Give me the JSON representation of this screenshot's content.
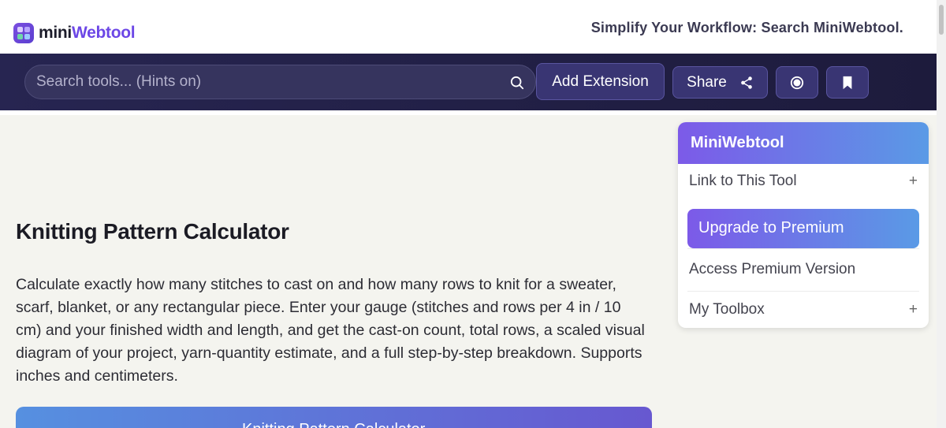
{
  "header": {
    "logo_part1": "mini",
    "logo_part2": "Webtool",
    "tagline": "Simplify Your Workflow: Search MiniWebtool."
  },
  "toolbar": {
    "search_placeholder": "Search tools... (Hints on)",
    "search_value": "",
    "add_extension_label": "Add Extension",
    "share_label": "Share",
    "icons": [
      "search-icon",
      "share-icon",
      "record-icon",
      "bookmark-icon"
    ]
  },
  "main": {
    "title": "Knitting Pattern Calculator",
    "description": "Calculate exactly how many stitches to cast on and how many rows to knit for a sweater, scarf, blanket, or any rectangular piece. Enter your gauge (stitches and rows per 4 in / 10 cm) and your finished width and length, and get the cast-on count, total rows, a scaled visual diagram of your project, yarn-quantity estimate, and a full step-by-step breakdown. Supports inches and centimeters.",
    "calculator_banner": "Knitting Pattern Calculator"
  },
  "sidebar": {
    "title": "MiniWebtool",
    "link_label": "Link to This Tool",
    "premium_button": "Upgrade to Premium",
    "access_label": "Access Premium Version",
    "toolbox_label": "My Toolbox",
    "expand_symbol": "+"
  },
  "colors": {
    "brand_purple": "#6c47e6",
    "toolbar_bg": "#272551",
    "button_bg": "#393573",
    "page_bg": "#f4f4ef",
    "gradient_start": "#7c5ae8",
    "gradient_end": "#5a9ae6"
  }
}
